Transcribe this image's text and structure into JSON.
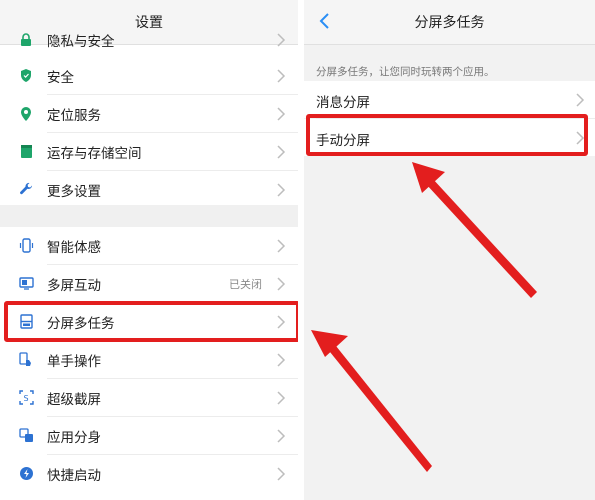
{
  "left_panel": {
    "title": "设置",
    "items": [
      {
        "label": "隐私与安全",
        "icon": "lock-icon"
      },
      {
        "label": "安全",
        "icon": "shield-icon"
      },
      {
        "label": "定位服务",
        "icon": "location-pin-icon"
      },
      {
        "label": "运存与存储空间",
        "icon": "storage-icon"
      },
      {
        "label": "更多设置",
        "icon": "wrench-icon"
      },
      {
        "label": "智能体感",
        "icon": "phone-motion-icon"
      },
      {
        "label": "多屏互动",
        "icon": "screen-cast-icon",
        "value": "已关闭"
      },
      {
        "label": "分屏多任务",
        "icon": "split-screen-icon"
      },
      {
        "label": "单手操作",
        "icon": "hand-icon"
      },
      {
        "label": "超级截屏",
        "icon": "screenshot-icon"
      },
      {
        "label": "应用分身",
        "icon": "app-clone-icon"
      },
      {
        "label": "快捷启动",
        "icon": "quick-launch-icon"
      }
    ]
  },
  "right_panel": {
    "title": "分屏多任务",
    "hint": "分屏多任务，让您同时玩转两个应用。",
    "items": [
      {
        "label": "消息分屏"
      },
      {
        "label": "手动分屏"
      }
    ]
  },
  "colors": {
    "highlight_red": "#e31e1e",
    "accent_green": "#1ea56a",
    "back_blue": "#2a8ef5"
  }
}
